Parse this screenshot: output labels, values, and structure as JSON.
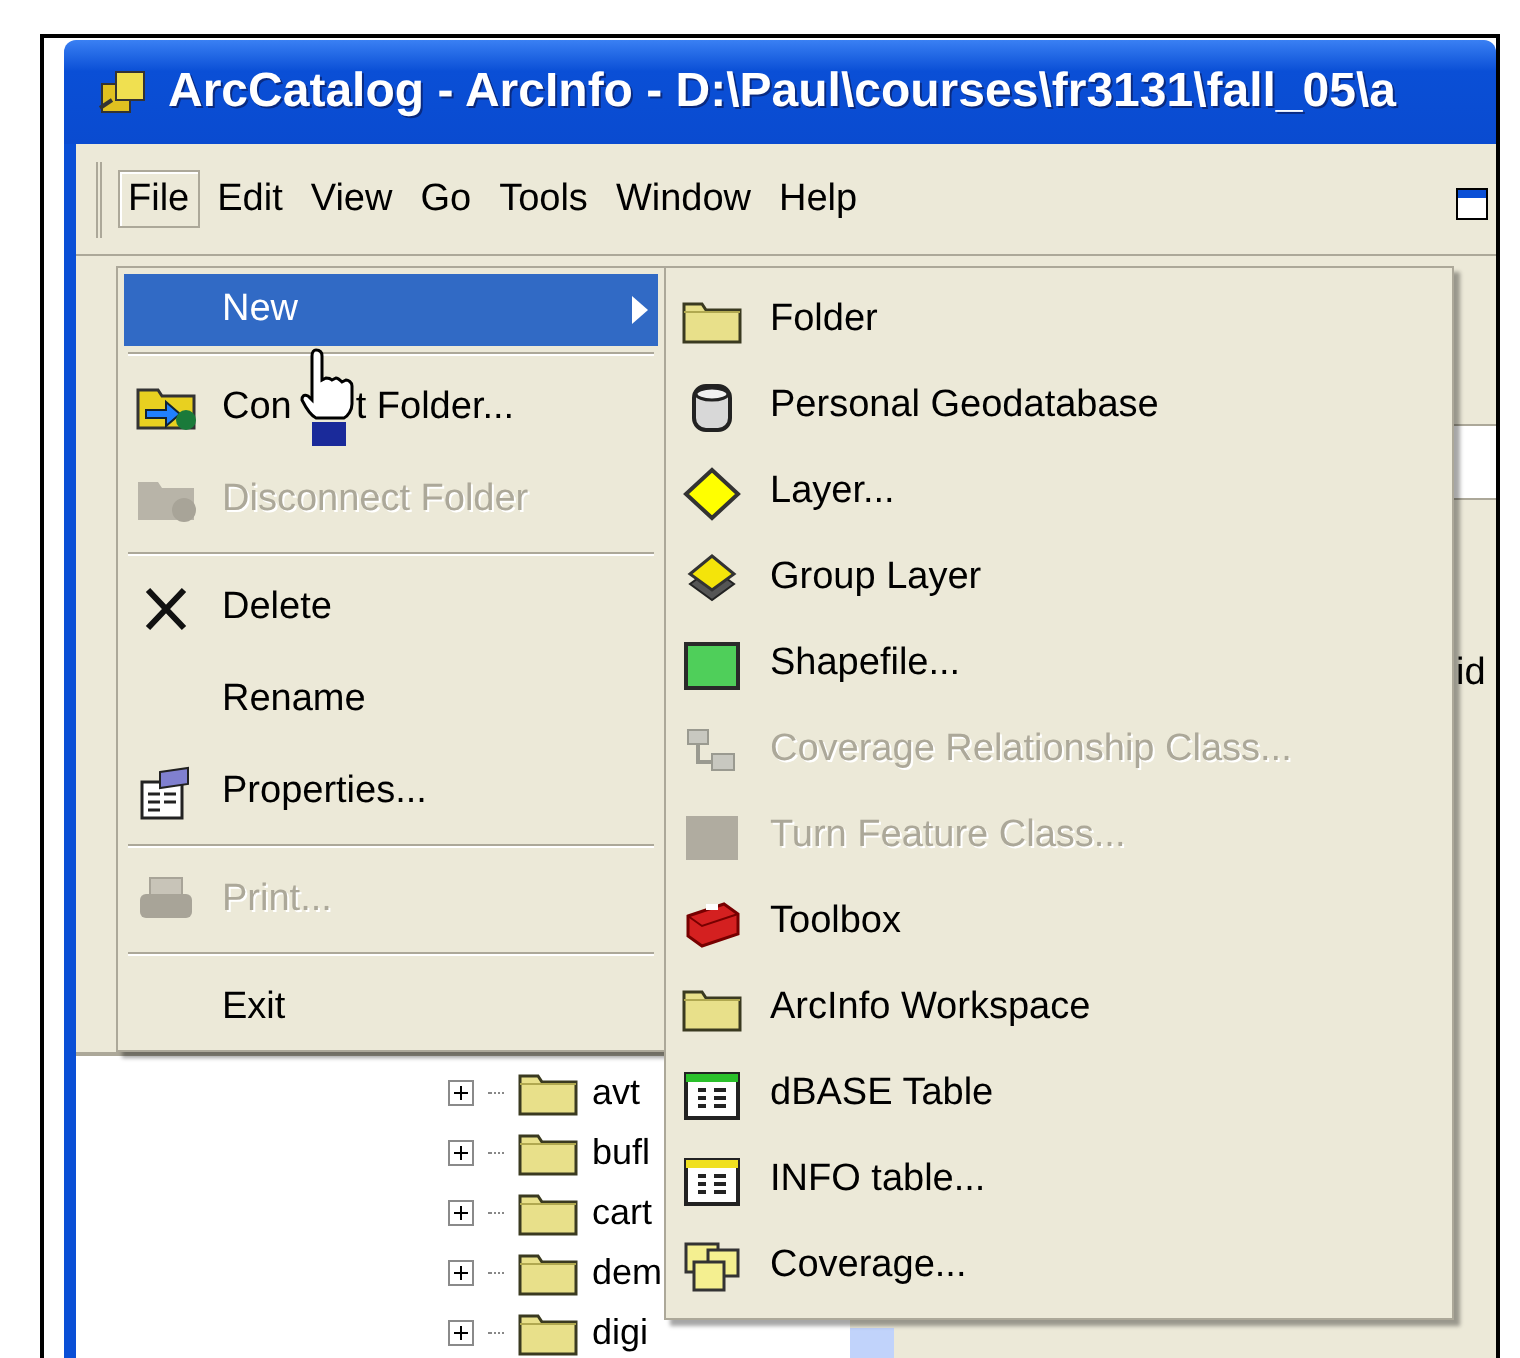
{
  "window": {
    "title": "ArcCatalog - ArcInfo - D:\\Paul\\courses\\fr3131\\fall_05\\a"
  },
  "menu_bar": [
    {
      "label": "File",
      "selected": true
    },
    {
      "label": "Edit",
      "selected": false
    },
    {
      "label": "View",
      "selected": false
    },
    {
      "label": "Go",
      "selected": false
    },
    {
      "label": "Tools",
      "selected": false
    },
    {
      "label": "Window",
      "selected": false
    },
    {
      "label": "Help",
      "selected": false
    }
  ],
  "file_menu": [
    {
      "kind": "submenu",
      "label": "New",
      "selected": true,
      "disabled": false
    },
    {
      "kind": "separator"
    },
    {
      "kind": "connect",
      "label": "Con",
      "label_after_cursor": "t Folder...",
      "selected": false,
      "disabled": false
    },
    {
      "kind": "disconnect",
      "label": "Disconnect Folder",
      "selected": false,
      "disabled": true
    },
    {
      "kind": "separator"
    },
    {
      "kind": "delete",
      "label": "Delete",
      "selected": false,
      "disabled": false
    },
    {
      "kind": "plain",
      "label": "Rename",
      "selected": false,
      "disabled": false
    },
    {
      "kind": "properties",
      "label": "Properties...",
      "selected": false,
      "disabled": false
    },
    {
      "kind": "separator"
    },
    {
      "kind": "print",
      "label": "Print...",
      "selected": false,
      "disabled": true
    },
    {
      "kind": "separator"
    },
    {
      "kind": "plain",
      "label": "Exit",
      "selected": false,
      "disabled": false
    }
  ],
  "new_submenu": [
    {
      "kind": "folder",
      "label": "Folder",
      "disabled": false
    },
    {
      "kind": "geodatabase",
      "label": "Personal Geodatabase",
      "disabled": false
    },
    {
      "kind": "layer",
      "label": "Layer...",
      "disabled": false
    },
    {
      "kind": "group_layer",
      "label": "Group Layer",
      "disabled": false
    },
    {
      "kind": "shapefile",
      "label": "Shapefile...",
      "disabled": false
    },
    {
      "kind": "relationship_class",
      "label": "Coverage Relationship Class...",
      "disabled": true
    },
    {
      "kind": "feature_class",
      "label": "Turn Feature Class...",
      "disabled": true
    },
    {
      "kind": "toolbox",
      "label": "Toolbox",
      "disabled": false
    },
    {
      "kind": "folder",
      "label": "ArcInfo Workspace",
      "disabled": false
    },
    {
      "kind": "dbase_table",
      "label": "dBASE Table",
      "disabled": false
    },
    {
      "kind": "info_table",
      "label": "INFO table...",
      "disabled": false
    },
    {
      "kind": "coverage",
      "label": "Coverage...",
      "disabled": false
    }
  ],
  "background_text": "id",
  "tree": [
    {
      "label": "avt",
      "expanded": false
    },
    {
      "label": "bufl",
      "expanded": false
    },
    {
      "label": "cart",
      "expanded": false
    },
    {
      "label": "dem",
      "expanded": false
    },
    {
      "label": "digi",
      "expanded": false
    }
  ]
}
